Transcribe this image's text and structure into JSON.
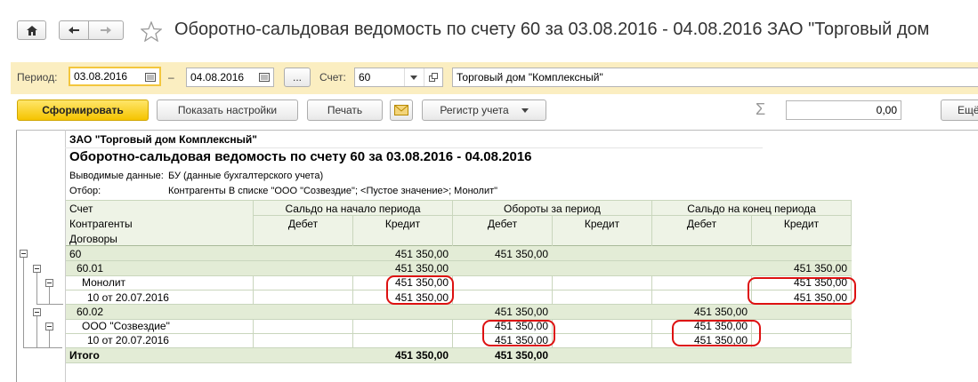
{
  "window": {
    "title": "Оборотно-сальдовая ведомость по счету 60 за 03.08.2016 - 04.08.2016 ЗАО \"Торговый дом"
  },
  "filters": {
    "period_label": "Период:",
    "date_from": "03.08.2016",
    "dash": "–",
    "date_to": "04.08.2016",
    "ellipsis": "...",
    "account_label": "Счет:",
    "account": "60",
    "organization": "Торговый дом \"Комплексный\""
  },
  "toolbar": {
    "generate": "Сформировать",
    "show_settings": "Показать настройки",
    "print": "Печать",
    "register": "Регистр учета",
    "sum_value": "0,00",
    "more": "Ещё"
  },
  "report": {
    "org": "ЗАО \"Торговый дом Комплексный\"",
    "title": "Оборотно-сальдовая ведомость по счету 60 за 03.08.2016 - 04.08.2016",
    "output_label": "Выводимые данные:",
    "output_value": "БУ (данные бухгалтерского учета)",
    "filter_label": "Отбор:",
    "filter_value": "Контрагенты В списке \"ООО \"Созвездие\"; <Пустое значение>; Монолит\"",
    "headers": {
      "account": "Счет",
      "contractors": "Контрагенты",
      "contracts": "Договоры",
      "opening": "Сальдо на начало периода",
      "turnover": "Обороты за период",
      "closing": "Сальдо на конец периода",
      "debit": "Дебет",
      "credit": "Кредит"
    },
    "rows": [
      {
        "name": "60",
        "ob_d": "",
        "ob_c": "451 350,00",
        "t_d": "451 350,00",
        "t_c": "",
        "cb_d": "",
        "cb_c": ""
      },
      {
        "name": "60.01",
        "ob_d": "",
        "ob_c": "451 350,00",
        "t_d": "",
        "t_c": "",
        "cb_d": "",
        "cb_c": "451 350,00"
      },
      {
        "name": "Монолит",
        "ob_d": "",
        "ob_c": "451 350,00",
        "t_d": "",
        "t_c": "",
        "cb_d": "",
        "cb_c": "451 350,00"
      },
      {
        "name": "10 от 20.07.2016",
        "ob_d": "",
        "ob_c": "451 350,00",
        "t_d": "",
        "t_c": "",
        "cb_d": "",
        "cb_c": "451 350,00"
      },
      {
        "name": "60.02",
        "ob_d": "",
        "ob_c": "",
        "t_d": "451 350,00",
        "t_c": "",
        "cb_d": "451 350,00",
        "cb_c": ""
      },
      {
        "name": "ООО \"Созвездие\"",
        "ob_d": "",
        "ob_c": "",
        "t_d": "451 350,00",
        "t_c": "",
        "cb_d": "451 350,00",
        "cb_c": ""
      },
      {
        "name": "10 от 20.07.2016",
        "ob_d": "",
        "ob_c": "",
        "t_d": "451 350,00",
        "t_c": "",
        "cb_d": "451 350,00",
        "cb_c": ""
      },
      {
        "name": "Итого",
        "ob_d": "",
        "ob_c": "451 350,00",
        "t_d": "451 350,00",
        "t_c": "",
        "cb_d": "",
        "cb_c": ""
      }
    ]
  },
  "colors": {
    "header_bg": "#eef3e6",
    "group_bg": "#e3ecd6",
    "highlight_oval": "#d11111",
    "primary_button": "#f5c400"
  }
}
